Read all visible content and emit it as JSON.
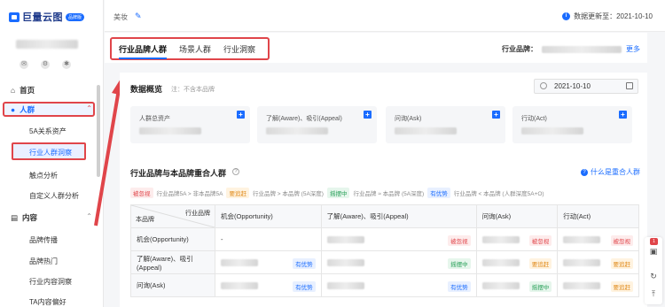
{
  "sidebar": {
    "logo_text": "巨量云图",
    "logo_badge": "品牌版",
    "home": "首页",
    "crowd_group": "人群",
    "crowd_items": [
      "5A关系资产",
      "行业人群洞察",
      "触点分析",
      "自定义人群分析"
    ],
    "content_group": "内容",
    "content_items": [
      "品牌传播",
      "品牌热门",
      "行业内容洞察",
      "TA内容偏好"
    ]
  },
  "topbar": {
    "breadcrumb": "美妆",
    "update_text": "数据更新至：2021-10-10"
  },
  "tabs": {
    "items": [
      "行业品牌人群",
      "场景人群",
      "行业洞察"
    ],
    "active_index": 0,
    "industry_label": "行业品牌：",
    "more": "更多"
  },
  "overview": {
    "title": "数据概览",
    "note": "注：不含本品牌",
    "date": "2021-10-10",
    "cards": [
      "人群总资产",
      "了解(Aware)、吸引(Appeal)",
      "问询(Ask)",
      "行动(Act)"
    ]
  },
  "overlap": {
    "title": "行业品牌与本品牌重合人群",
    "help_link": "什么是重合人群",
    "legend": [
      {
        "tag": "被忽视",
        "color": "red",
        "text": "行业品牌5A > 非本品牌5A"
      },
      {
        "tag": "要追赶",
        "color": "orange",
        "text": "行业品牌 > 本品牌 (5A深度)"
      },
      {
        "tag": "摇摆中",
        "color": "green",
        "text": "行业品牌 ≈ 本品牌 (5A深度)"
      },
      {
        "tag": "有优势",
        "color": "blue",
        "text": "行业品牌 < 本品牌 (人群深度5A+O)"
      }
    ],
    "table": {
      "corner_top": "行业品牌",
      "corner_bottom": "本品牌",
      "columns": [
        "机会(Opportunity)",
        "了解(Aware)、吸引(Appeal)",
        "问询(Ask)",
        "行动(Act)"
      ],
      "rows": [
        {
          "label": "机会(Opportunity)",
          "cells": [
            {
              "text": "-",
              "tag": ""
            },
            {
              "text": "",
              "tag": "被忽视",
              "color": "red"
            },
            {
              "text": "",
              "tag": "被忽视",
              "color": "red"
            },
            {
              "text": "",
              "tag": "被忽视",
              "color": "red"
            }
          ]
        },
        {
          "label": "了解(Aware)、吸引(Appeal)",
          "cells": [
            {
              "text": "",
              "tag": "有优势",
              "color": "blue"
            },
            {
              "text": "",
              "tag": "摇摆中",
              "color": "green"
            },
            {
              "text": "",
              "tag": "要追赶",
              "color": "orange"
            },
            {
              "text": "",
              "tag": "要追赶",
              "color": "orange"
            }
          ]
        },
        {
          "label": "问询(Ask)",
          "cells": [
            {
              "text": "",
              "tag": "有优势",
              "color": "blue"
            },
            {
              "text": "",
              "tag": "有优势",
              "color": "blue"
            },
            {
              "text": "",
              "tag": "摇摆中",
              "color": "green"
            },
            {
              "text": "",
              "tag": "要追赶",
              "color": "orange"
            }
          ]
        }
      ]
    }
  },
  "float": {
    "notif_count": "1"
  }
}
